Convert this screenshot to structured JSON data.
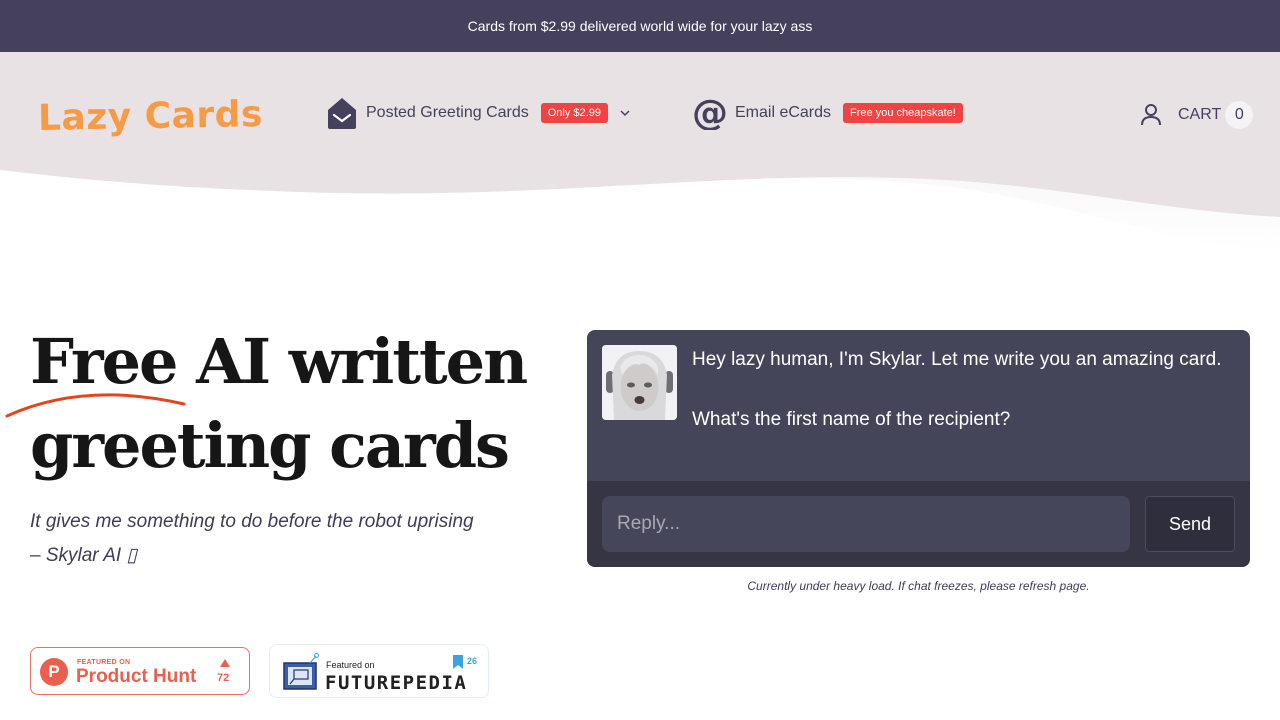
{
  "announcement": "Cards from $2.99 delivered world wide for your lazy ass",
  "brand": {
    "logo_text": "Lazy Cards",
    "colors": {
      "logo": "#f59a45",
      "nav_dark": "#45405c",
      "badge_red": "#f04343",
      "header_bg": "#e8e2e5",
      "accent_swoosh": "#e2461c"
    }
  },
  "nav": {
    "items": [
      {
        "label": "Posted Greeting Cards",
        "badge": "Only $2.99",
        "icon": "envelope-open-icon",
        "has_dropdown": true
      },
      {
        "label": "Email eCards",
        "badge": "Free you cheapskate!",
        "icon": "at-sign-icon",
        "has_dropdown": false
      }
    ],
    "account_icon": "user-icon",
    "cart_label": "CART",
    "cart_count": "0"
  },
  "hero": {
    "title_line1": "Free AI written",
    "title_line2": "greeting cards",
    "tagline": "It gives me something to do before the robot uprising – Skylar AI ▯"
  },
  "chat": {
    "bot_name": "Skylar",
    "avatar_icon": "skylar-avatar",
    "messages": [
      "Hey lazy human, I'm Skylar. Let me write you an amazing card.",
      "What's the first name of the recipient?"
    ],
    "reply_value": "",
    "reply_placeholder": "Reply...",
    "send_label": "Send",
    "load_note": "Currently under heavy load. If chat freezes, please refresh page."
  },
  "badges": {
    "product_hunt": {
      "small": "FEATURED ON",
      "big": "Product Hunt",
      "count": "72"
    },
    "futurepedia": {
      "small": "Featured on",
      "big": "FUTUREPEDIA",
      "count": "26"
    }
  }
}
